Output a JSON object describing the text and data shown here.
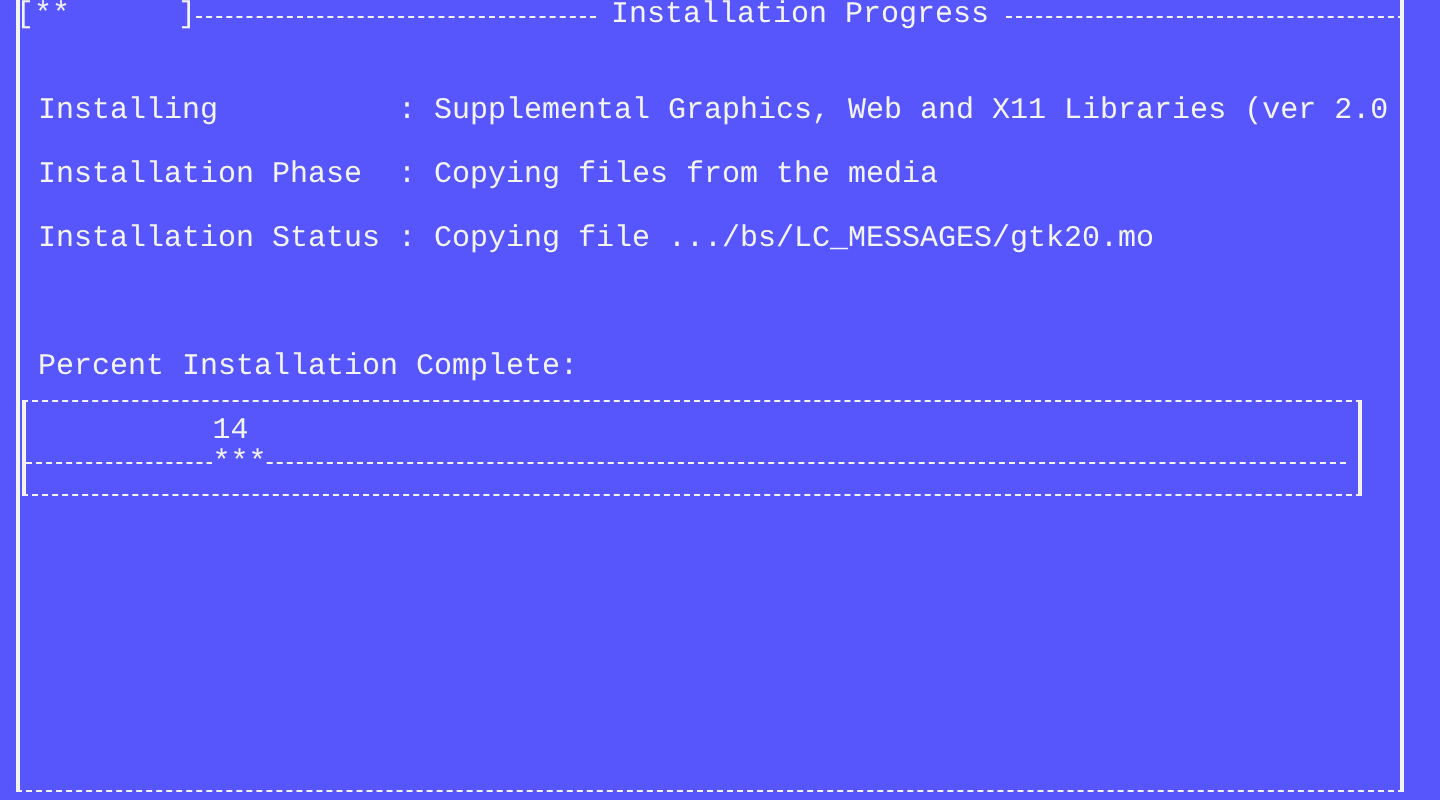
{
  "window": {
    "spinner": "[**      ]",
    "title": "Installation Progress"
  },
  "info_rows": [
    {
      "label": "Installing",
      "separator": ":",
      "value": "Supplemental Graphics, Web and X11 Libraries (ver 2.0"
    },
    {
      "label": "Installation Phase",
      "separator": ":",
      "value": "Copying files from the media"
    },
    {
      "label": "Installation Status",
      "separator": ":",
      "value": "Copying file .../bs/LC_MESSAGES/gtk20.mo"
    }
  ],
  "progress": {
    "label": "Percent Installation Complete:",
    "percent_text": "14",
    "marker": "***",
    "level": 0.14
  }
}
